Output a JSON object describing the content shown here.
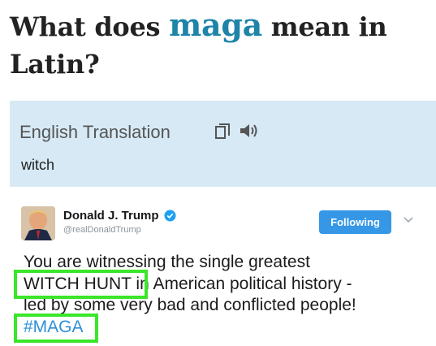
{
  "headline": {
    "before": "What does ",
    "highlight": "maga",
    "after": " mean in Latin?"
  },
  "translation": {
    "title": "English Translation",
    "word": "witch",
    "copy_icon": "copy-icon",
    "speaker_icon": "speaker-icon"
  },
  "tweet": {
    "name": "Donald J. Trump",
    "handle": "@realDonaldTrump",
    "follow_label": "Following",
    "line1": "You are witnessing the single greatest",
    "line2_highlight": "WITCH HUNT",
    "line2_rest": " in American political history -",
    "line3": "led by some very bad and conflicted people!",
    "hashtag": "#MAGA"
  },
  "colors": {
    "headline_highlight": "#1e84a8",
    "translation_bg": "#d6e9f5",
    "follow_button": "#3597e6",
    "hashtag": "#2c8fd6",
    "highlight_box": "#39e62a"
  }
}
